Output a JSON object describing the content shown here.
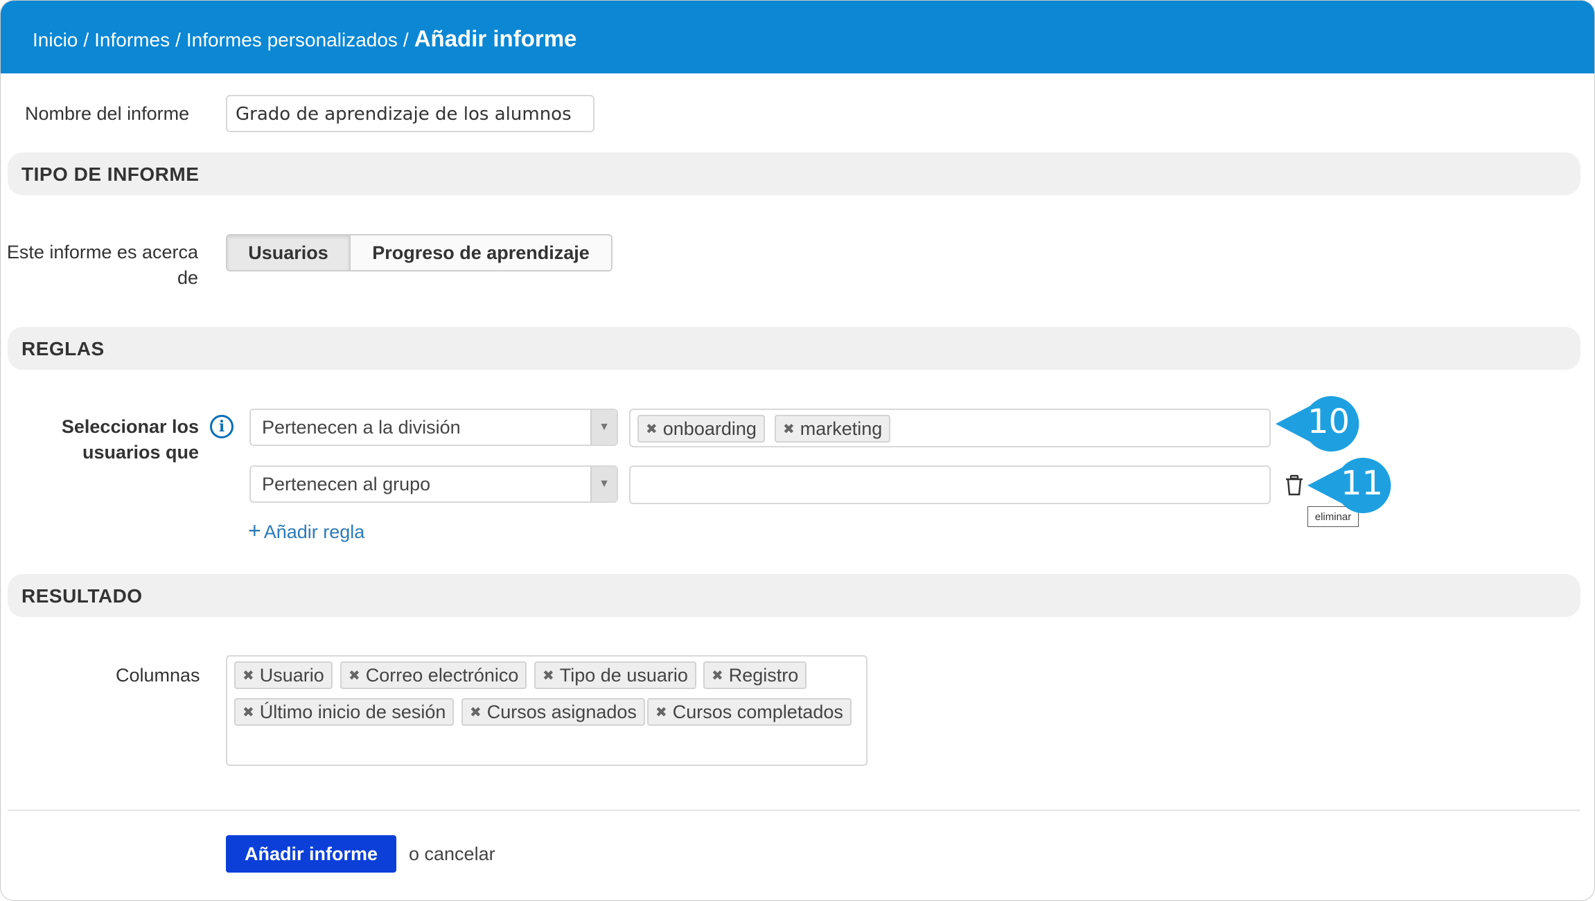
{
  "breadcrumb": {
    "items": [
      "Inicio",
      "Informes",
      "Informes personalizados"
    ],
    "separator": "/",
    "current": "Añadir informe"
  },
  "report_name": {
    "label": "Nombre del informe",
    "value": "Grado de aprendizaje de los alumnos"
  },
  "report_type": {
    "section_title": "TIPO DE INFORME",
    "about_label_line1": "Este informe es acerca",
    "about_label_line2": "de",
    "options": [
      "Usuarios",
      "Progreso de aprendizaje"
    ],
    "selected": "Usuarios"
  },
  "rules": {
    "section_title": "REGLAS",
    "label_line1": "Seleccionar los",
    "label_line2": "usuarios que",
    "rows": [
      {
        "condition": "Pertenecen a la división",
        "tags": [
          "onboarding",
          "marketing"
        ]
      },
      {
        "condition": "Pertenecen al grupo",
        "tags": []
      }
    ],
    "add_rule_label": "Añadir regla",
    "delete_tooltip": "eliminar"
  },
  "callouts": [
    "10",
    "11"
  ],
  "result": {
    "section_title": "RESULTADO",
    "columns_label": "Columnas",
    "columns": [
      "Usuario",
      "Correo electrónico",
      "Tipo de usuario",
      "Registro",
      "Último inicio de sesión",
      "Cursos asignados",
      "Cursos completados"
    ]
  },
  "actions": {
    "submit_label": "Añadir informe",
    "cancel_label": "o cancelar"
  },
  "colors": {
    "header": "#0b87d4",
    "primary_button": "#0b3fd8",
    "callout": "#1ea0e0",
    "link": "#2b7ab8"
  }
}
